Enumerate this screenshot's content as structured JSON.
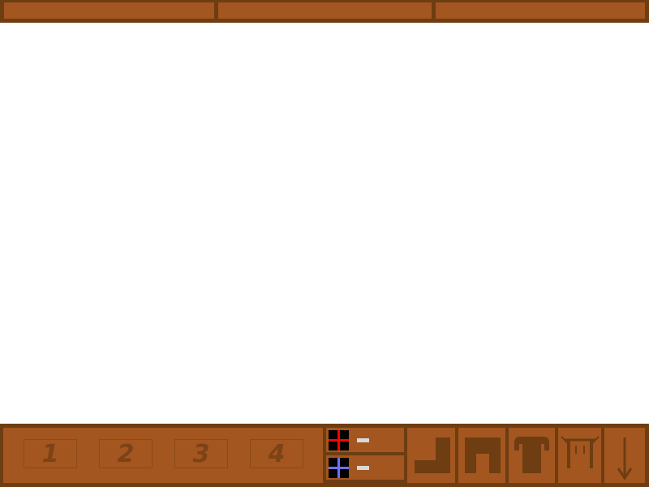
{
  "top_bar": {
    "panels": [
      "",
      "",
      ""
    ]
  },
  "hotbar": {
    "slots": [
      {
        "label": "1"
      },
      {
        "label": "2"
      },
      {
        "label": "3"
      },
      {
        "label": "4"
      }
    ]
  },
  "stats": {
    "health": {
      "icon": "red-cross-icon",
      "color": "#ff0000",
      "level": 0
    },
    "mana": {
      "icon": "blue-cross-icon",
      "color": "#7070ff",
      "level": 0
    }
  },
  "equipment": [
    {
      "name": "boots-slot",
      "icon": "boot-icon"
    },
    {
      "name": "pants-slot",
      "icon": "pants-icon"
    },
    {
      "name": "shirt-slot",
      "icon": "shirt-icon"
    },
    {
      "name": "table-slot",
      "icon": "table-icon"
    },
    {
      "name": "drop-slot",
      "icon": "down-arrow-icon"
    }
  ],
  "colors": {
    "frame": "#6e3d12",
    "panel": "#a3561f",
    "glyph": "#7d4216"
  }
}
